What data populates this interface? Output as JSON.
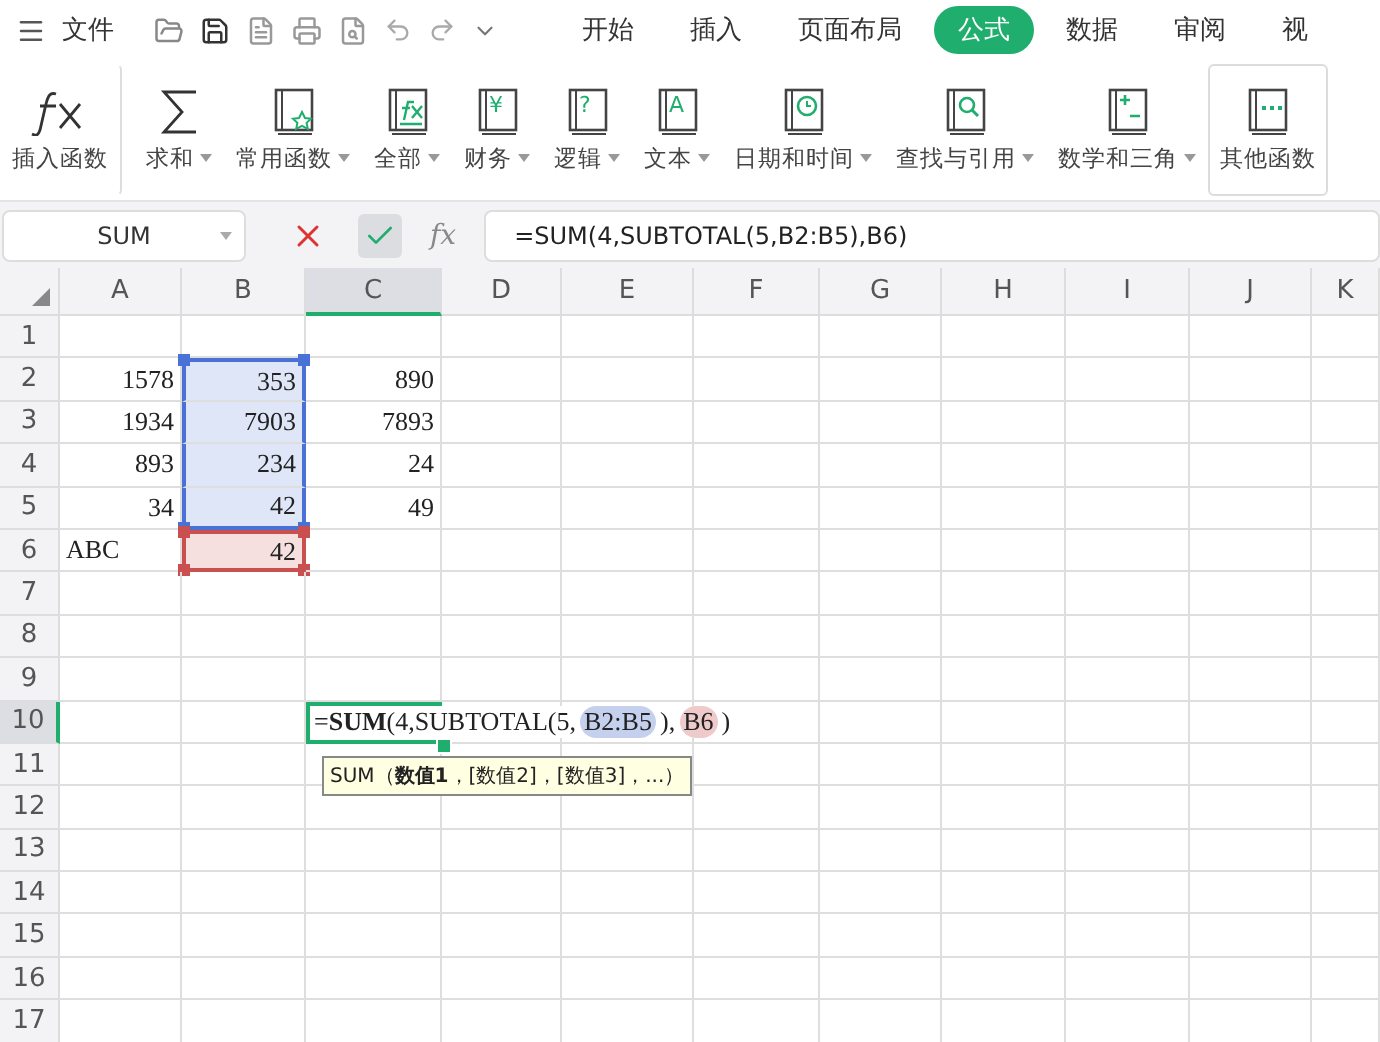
{
  "menu_bar": {
    "file_label": "文件",
    "tabs": [
      {
        "label": "开始",
        "selected": false
      },
      {
        "label": "插入",
        "selected": false
      },
      {
        "label": "页面布局",
        "selected": false
      },
      {
        "label": "公式",
        "selected": true
      },
      {
        "label": "数据",
        "selected": false
      },
      {
        "label": "审阅",
        "selected": false
      },
      {
        "label": "视",
        "selected": false
      }
    ]
  },
  "ribbon": {
    "items": [
      {
        "label": "插入函数",
        "kind": "fx",
        "caret": false,
        "highlighted": false
      },
      {
        "label": "求和",
        "kind": "sigma",
        "caret": true,
        "highlighted": false
      },
      {
        "label": "常用函数",
        "kind": "star-book",
        "caret": true,
        "highlighted": false
      },
      {
        "label": "全部",
        "kind": "fx-book",
        "caret": true,
        "highlighted": false
      },
      {
        "label": "财务",
        "kind": "glyph-book",
        "glyph": "¥",
        "caret": true,
        "highlighted": false
      },
      {
        "label": "逻辑",
        "kind": "glyph-book",
        "glyph": "?",
        "caret": true,
        "highlighted": false
      },
      {
        "label": "文本",
        "kind": "glyph-book",
        "glyph": "A",
        "caret": true,
        "highlighted": false
      },
      {
        "label": "日期和时间",
        "kind": "clock-book",
        "caret": true,
        "highlighted": false
      },
      {
        "label": "查找与引用",
        "kind": "search-book",
        "caret": true,
        "highlighted": false
      },
      {
        "label": "数学和三角",
        "kind": "math-book",
        "caret": true,
        "highlighted": false
      },
      {
        "label": "其他函数",
        "kind": "dots-book",
        "caret": false,
        "highlighted": true
      }
    ]
  },
  "formula_bar": {
    "name_box": "SUM",
    "value": "=SUM(4,SUBTOTAL(5,B2:B5),B6)"
  },
  "sheet": {
    "columns": [
      {
        "label": "A",
        "selected": false
      },
      {
        "label": "B",
        "selected": false
      },
      {
        "label": "C",
        "selected": true
      },
      {
        "label": "D",
        "selected": false
      },
      {
        "label": "E",
        "selected": false
      },
      {
        "label": "F",
        "selected": false
      },
      {
        "label": "G",
        "selected": false
      },
      {
        "label": "H",
        "selected": false
      },
      {
        "label": "I",
        "selected": false
      },
      {
        "label": "J",
        "selected": false
      },
      {
        "label": "K",
        "selected": false
      }
    ],
    "rows": [
      {
        "label": "1",
        "selected": false,
        "cells": []
      },
      {
        "label": "2",
        "selected": false,
        "cells": [
          {
            "kind": "number",
            "text": "1578"
          },
          {
            "kind": "number",
            "text": "353",
            "color": "#4a72d6"
          },
          {
            "kind": "number",
            "text": "890"
          }
        ]
      },
      {
        "label": "3",
        "selected": false,
        "cells": [
          {
            "kind": "number",
            "text": "1934"
          },
          {
            "kind": "number",
            "text": "7903",
            "color": "#4a72d6"
          },
          {
            "kind": "number",
            "text": "7893"
          }
        ]
      },
      {
        "label": "4",
        "selected": false,
        "cells": [
          {
            "kind": "number",
            "text": "893"
          },
          {
            "kind": "number",
            "text": "234",
            "color": "#4a72d6"
          },
          {
            "kind": "number",
            "text": "24"
          }
        ]
      },
      {
        "label": "5",
        "selected": false,
        "cells": [
          {
            "kind": "number",
            "text": "34"
          },
          {
            "kind": "number",
            "text": "42",
            "color": "#4a72d6"
          },
          {
            "kind": "number",
            "text": "49"
          }
        ]
      },
      {
        "label": "6",
        "selected": false,
        "cells": [
          {
            "kind": "text",
            "text": "ABC"
          },
          {
            "kind": "number",
            "text": "42",
            "color": "#c9504f"
          }
        ]
      },
      {
        "label": "7",
        "selected": false,
        "cells": []
      },
      {
        "label": "8",
        "selected": false,
        "cells": []
      },
      {
        "label": "9",
        "selected": false,
        "cells": []
      },
      {
        "label": "10",
        "selected": true,
        "cells": [
          null,
          null,
          {
            "kind": "editing",
            "segments": [
              {
                "text": "=**SUM**(4,SUBTOTAL(5,"
              },
              {
                "text": "B2:B5",
                "color": "#c5d0ee"
              },
              {
                "text": "),"
              },
              {
                "text": "B6",
                "color": "#efcaca"
              },
              {
                "text": ")"
              }
            ],
            "hint": "SUM（**数值1**，[数值2]，[数值3]，...）"
          }
        ]
      },
      {
        "label": "11",
        "selected": false,
        "cells": []
      },
      {
        "label": "12",
        "selected": false,
        "cells": []
      },
      {
        "label": "13",
        "selected": false,
        "cells": []
      },
      {
        "label": "14",
        "selected": false,
        "cells": []
      },
      {
        "label": "15",
        "selected": false,
        "cells": []
      },
      {
        "label": "16",
        "selected": false,
        "cells": []
      },
      {
        "label": "17",
        "selected": false,
        "cells": []
      }
    ]
  }
}
